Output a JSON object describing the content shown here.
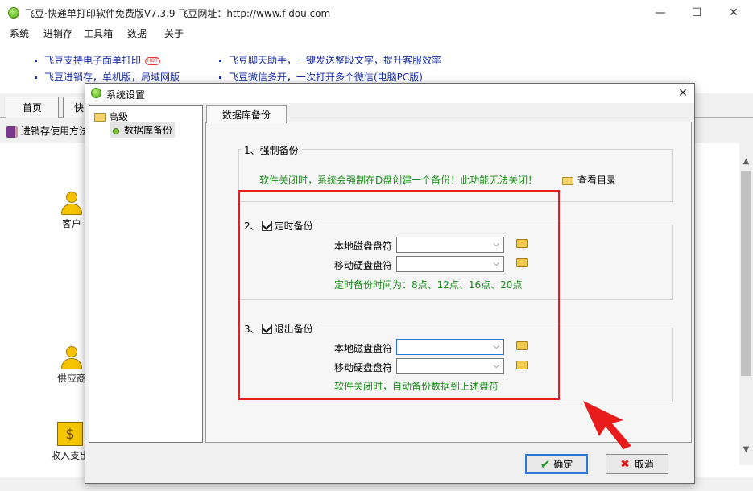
{
  "app": {
    "title": "飞豆·快递单打印软件免费版V7.3.9   飞豆网址：http://www.f-dou.com",
    "menu": [
      "系统",
      "进销存",
      "工具箱",
      "数据",
      "关于"
    ],
    "window_controls": {
      "minimize": "—",
      "maximize": "☐",
      "close": "✕"
    }
  },
  "ads": [
    {
      "text": "飞豆支持电子面单打印",
      "badge": "HOT"
    },
    {
      "text": "飞豆聊天助手，一键发送整段文字，提升客服效率"
    },
    {
      "text": "飞豆进销存，单机版，局域网版"
    },
    {
      "text": "飞豆微信多开，一次打开多个微信(电脑PC版)"
    }
  ],
  "tabs": {
    "home": "首页",
    "second": "快"
  },
  "toolbar": {
    "guide": "进销存使用方法"
  },
  "workspace": {
    "customer": "客户",
    "supplier": "供应商",
    "income": "收入支出",
    "income_icon": "$"
  },
  "dialog": {
    "title": "系统设置",
    "close": "✕",
    "tree": {
      "root": "高级",
      "child": "数据库备份"
    },
    "tab": "数据库备份",
    "section1": {
      "title": "1、强制备份",
      "notice": "软件关闭时，系统会强制在D盘创建一个备份！此功能无法关闭！",
      "view_dir": "查看目录"
    },
    "section2": {
      "prefix": "2、",
      "title": "定时备份",
      "checked": true,
      "local_label": "本地磁盘盘符",
      "local_value": "",
      "mobile_label": "移动硬盘盘符",
      "mobile_value": "",
      "hint": "定时备份时间为：8点、12点、16点、20点"
    },
    "section3": {
      "prefix": "3、",
      "title": "退出备份",
      "checked": true,
      "local_label": "本地磁盘盘符",
      "local_value": "",
      "mobile_label": "移动硬盘盘符",
      "mobile_value": "",
      "hint": "软件关闭时，自动备份数据到上述盘符"
    },
    "ok": "确定",
    "cancel": "取消"
  },
  "colors": {
    "highlight": "#e81c1c",
    "green_text": "#1a8c1a",
    "link_blue": "#1a2fa8",
    "focus_blue": "#2a78d6"
  }
}
